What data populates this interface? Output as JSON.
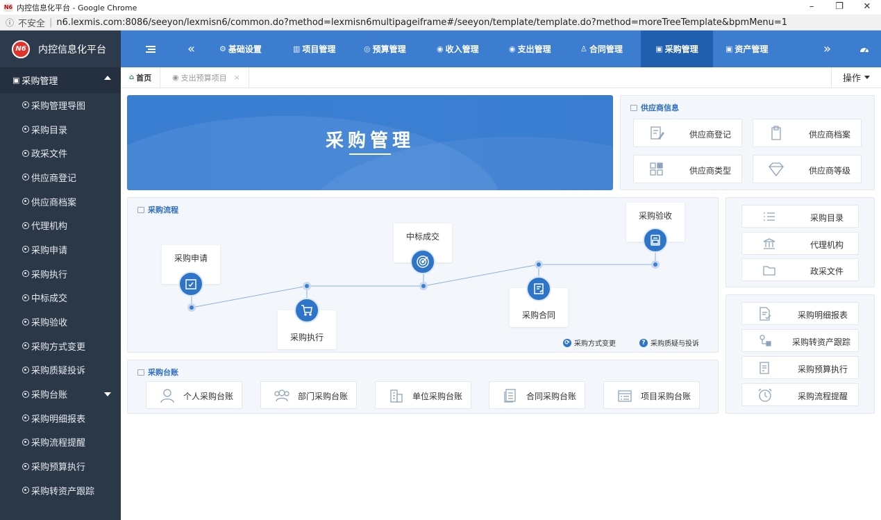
{
  "browser": {
    "title": "内控信息化平台 - Google Chrome",
    "favicon_text": "N6",
    "security": "不安全",
    "url": "n6.lexmis.com:8086/seeyon/lexmisn6/common.do?method=lexmisn6multipageiframe#/seeyon/template/template.do?method=moreTreeTemplate&bpmMenu=1"
  },
  "brand": {
    "logo": "N6",
    "name": "内控信息化平台"
  },
  "topnav": [
    {
      "label": "基础设置",
      "icon": "gear-icon",
      "glyph": "⚙"
    },
    {
      "label": "项目管理",
      "icon": "bar-chart-icon",
      "glyph": "▥"
    },
    {
      "label": "预算管理",
      "icon": "clock-icon",
      "glyph": "◎"
    },
    {
      "label": "收入管理",
      "icon": "circle-arrow-icon",
      "glyph": "◉"
    },
    {
      "label": "支出管理",
      "icon": "circle-arrow-icon",
      "glyph": "◉"
    },
    {
      "label": "合同管理",
      "icon": "user-icon",
      "glyph": "♙"
    },
    {
      "label": "采购管理",
      "icon": "grid-icon",
      "glyph": "▣"
    },
    {
      "label": "资产管理",
      "icon": "grid-icon",
      "glyph": "▣"
    }
  ],
  "sidebar": {
    "group_label": "采购管理",
    "items": [
      {
        "label": "采购管理导图"
      },
      {
        "label": "采购目录"
      },
      {
        "label": "政采文件"
      },
      {
        "label": "供应商登记"
      },
      {
        "label": "供应商档案"
      },
      {
        "label": "代理机构"
      },
      {
        "label": "采购申请"
      },
      {
        "label": "采购执行"
      },
      {
        "label": "中标成交"
      },
      {
        "label": "采购验收"
      },
      {
        "label": "采购方式变更"
      },
      {
        "label": "采购质疑投诉"
      },
      {
        "label": "采购台账"
      },
      {
        "label": "采购明细报表"
      },
      {
        "label": "采购流程提醒"
      },
      {
        "label": "采购预算执行"
      },
      {
        "label": "采购转资产跟踪"
      }
    ]
  },
  "tabs": {
    "home": "首页",
    "other": "支出预算项目",
    "close": "×",
    "ops": "操作"
  },
  "banner": {
    "title": "采购管理"
  },
  "supplier": {
    "title": "供应商信息",
    "cards": [
      "供应商登记",
      "供应商档案",
      "供应商类型",
      "供应商等级"
    ]
  },
  "flow": {
    "title": "采购流程",
    "steps": [
      "采购申请",
      "采购执行",
      "中标成交",
      "采购合同",
      "采购验收"
    ],
    "legend": [
      "采购方式变更",
      "采购质疑与投诉"
    ]
  },
  "quick": {
    "group1": [
      "采购目录",
      "代理机构",
      "政采文件"
    ],
    "group2": [
      "采购明细报表",
      "采购转资产跟踪",
      "采购预算执行",
      "采购流程提醒"
    ]
  },
  "ledger": {
    "title": "采购台账",
    "cards": [
      "个人采购台账",
      "部门采购台账",
      "单位采购台账",
      "合同采购台账",
      "项目采购台账"
    ]
  }
}
